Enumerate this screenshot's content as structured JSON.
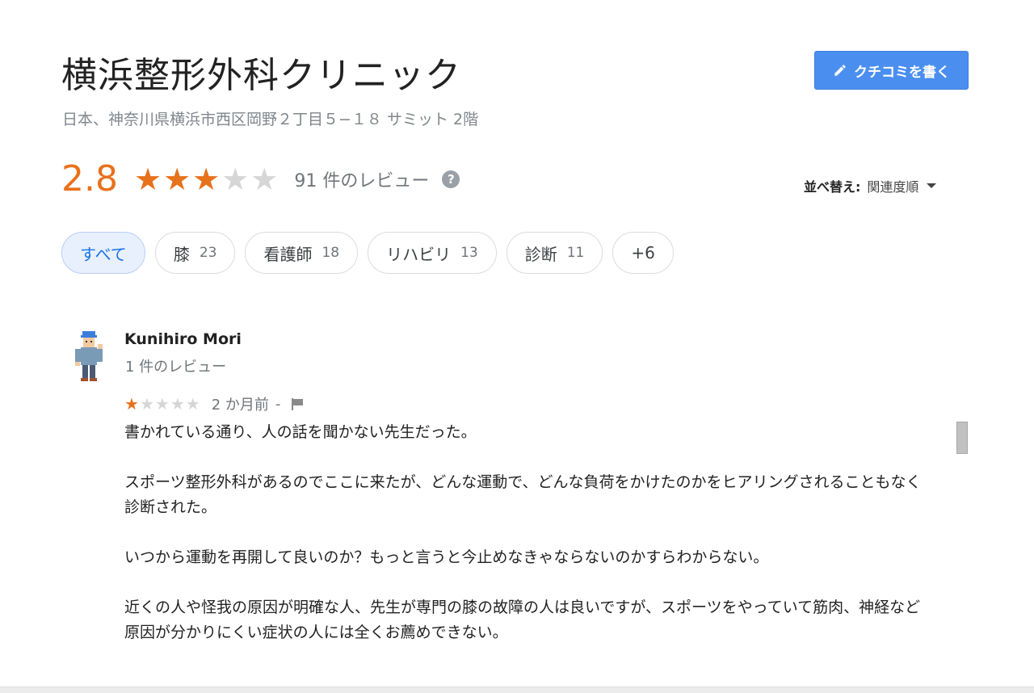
{
  "business": {
    "name": "横浜整形外科クリニック",
    "address": "日本、神奈川県横浜市西区岡野２丁目５−１８ サミット 2階"
  },
  "write_review_label": "クチコミを書く",
  "rating": {
    "value": "2.8",
    "stars_filled": 3,
    "stars_total": 5,
    "review_count_text": "91 件のレビュー",
    "help_icon": "?"
  },
  "sort": {
    "label": "並べ替え:",
    "value": "関連度順"
  },
  "chips": [
    {
      "label": "すべて",
      "count": ""
    },
    {
      "label": "膝",
      "count": "23"
    },
    {
      "label": "看護師",
      "count": "18"
    },
    {
      "label": "リハビリ",
      "count": "13"
    },
    {
      "label": "診断",
      "count": "11"
    },
    {
      "label": "+6",
      "count": ""
    }
  ],
  "review": {
    "author": "Kunihiro Mori",
    "author_review_count": "1 件のレビュー",
    "stars_filled": 1,
    "stars_total": 5,
    "date": "2 か月前",
    "separator": "-",
    "paragraphs": [
      "書かれている通り、人の話を聞かない先生だった。",
      "スポーツ整形外科があるのでここに来たが、どんな運動で、どんな負荷をかけたのかをヒアリングされることもなく診断された。",
      "いつから運動を再開して良いのか？もっと言うと今止めなきゃならないのかすらわからない。",
      "近くの人や怪我の原因が明確な人、先生が専門の膝の故障の人は良いですが、スポーツをやっていて筋肉、神経など原因が分かりにくい症状の人には全くお薦めできない。"
    ]
  },
  "icons": {
    "write": "pencil-icon",
    "help": "help-icon",
    "sort": "caret-down-icon",
    "flag": "flag-icon",
    "avatar": "avatar-icon",
    "star": "star-icon"
  },
  "colors": {
    "accent": "#e8711c",
    "button": "#4a8ff0",
    "chip_selected_bg": "#e8f0fe",
    "chip_selected_text": "#1a73e8",
    "star_empty": "#d6d6d6"
  }
}
